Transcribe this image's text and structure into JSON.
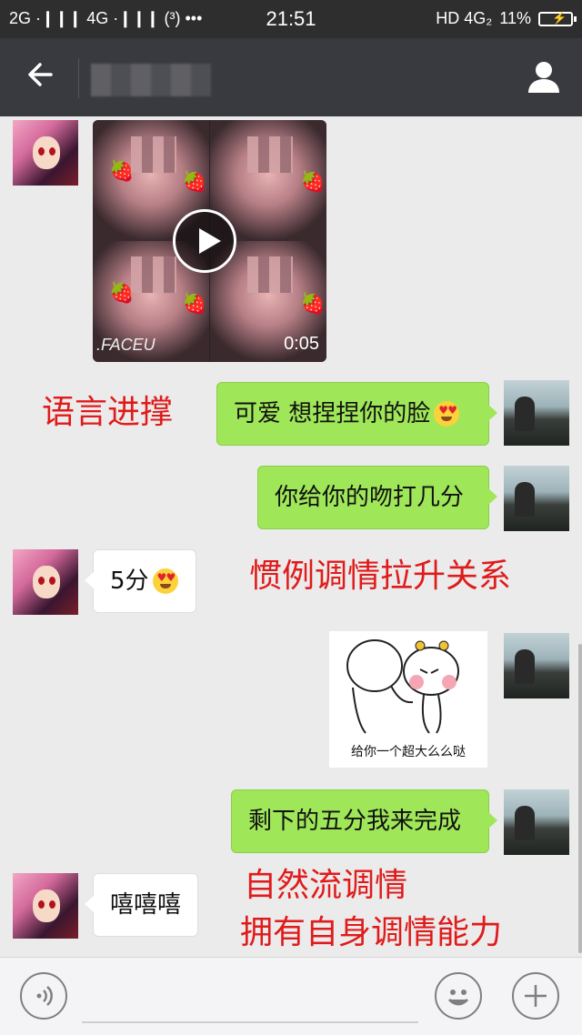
{
  "status_bar": {
    "left": "2G ·❙❙❙ 4G ·❙❙❙ (³) •••",
    "time": "21:51",
    "network": "HD 4G₂",
    "battery": "11%"
  },
  "header": {
    "contact_name": ""
  },
  "messages": [
    {
      "side": "left",
      "type": "video",
      "duration": "0:05",
      "watermark": ".FACEU"
    },
    {
      "side": "right",
      "type": "text",
      "text": "可爱 想捏捏你的脸",
      "emoji": "heart-eyes"
    },
    {
      "side": "right",
      "type": "text",
      "text": "你给你的吻打几分"
    },
    {
      "side": "left",
      "type": "text",
      "text": "5分",
      "emoji": "heart-eyes"
    },
    {
      "side": "right",
      "type": "sticker",
      "caption": "给你一个超大么么哒"
    },
    {
      "side": "right",
      "type": "text",
      "text": "剩下的五分我来完成"
    },
    {
      "side": "left",
      "type": "text",
      "text": "嘻嘻嘻"
    }
  ],
  "annotations": [
    "语言进撑",
    "惯例调情拉升关系",
    "自然流调情",
    "拥有自身调情能力"
  ],
  "colors": {
    "accent_annotation": "#e01b1b",
    "bubble_sent": "#9fe658",
    "title_bar": "#393a3f"
  },
  "icons": [
    "back-arrow-icon",
    "profile-icon",
    "voice-icon",
    "emoji-icon",
    "plus-icon",
    "play-icon"
  ]
}
